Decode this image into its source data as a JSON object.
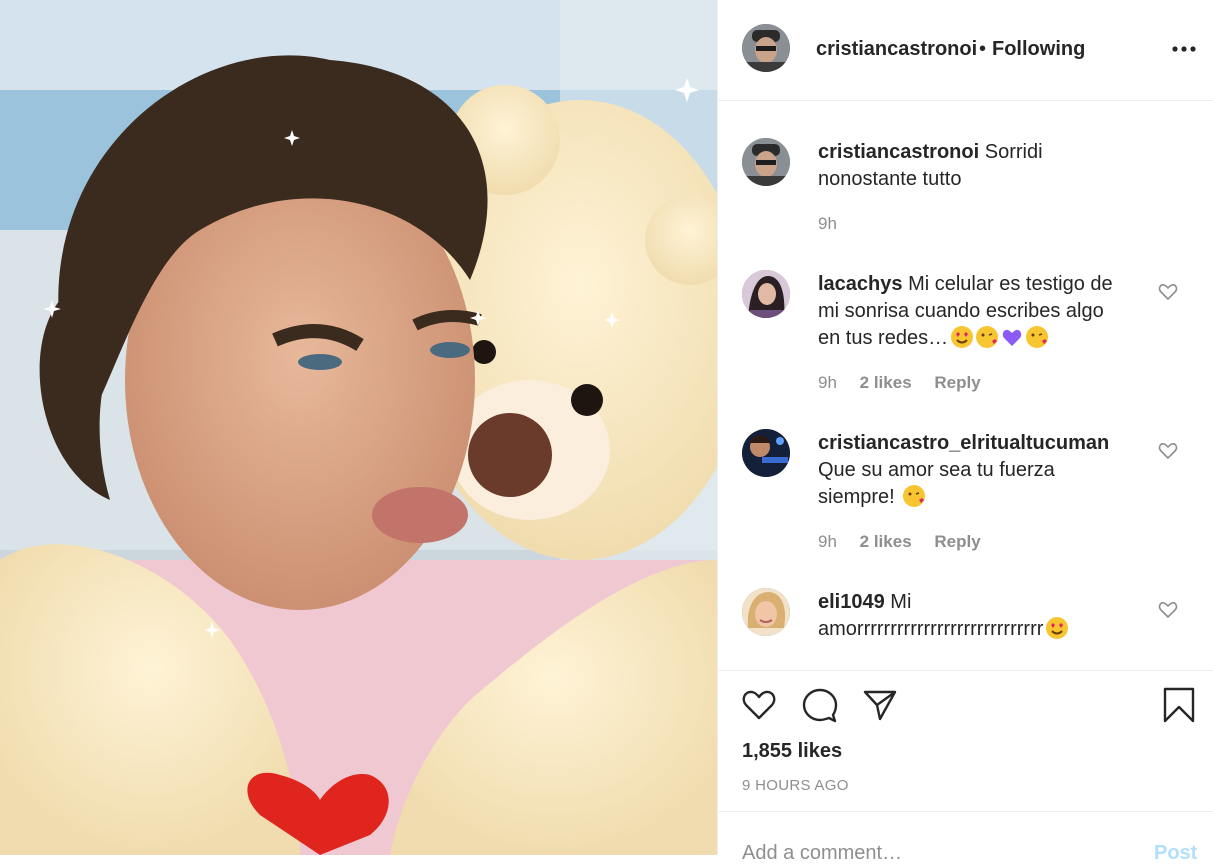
{
  "post": {
    "username": "cristiancastronoi",
    "separator": "•",
    "follow_status": "Following",
    "more_icon": "more-horizontal-icon",
    "caption": {
      "username": "cristiancastronoi",
      "text": "Sorridi nonostante tutto",
      "time": "9h"
    },
    "comments": [
      {
        "username": "lacachys",
        "text": "Mi celular es testigo de mi sonrisa cuando escribes algo en tus redes…",
        "emojis": [
          "heart-eyes",
          "kiss",
          "purple-heart",
          "kiss"
        ],
        "time": "9h",
        "likes": "2 likes",
        "reply": "Reply"
      },
      {
        "username": "cristiancastro_elritualtucuman",
        "text": "Que su amor sea tu fuerza siempre!",
        "emojis": [
          "kiss"
        ],
        "time": "9h",
        "likes": "2 likes",
        "reply": "Reply"
      },
      {
        "username": "eli1049",
        "text": "Mi amorrrrrrrrrrrrrrrrrrrrrrrrrrrr",
        "emojis": [
          "heart-eyes"
        ]
      }
    ],
    "likes": "1,855 likes",
    "posted_ago": "9 HOURS AGO",
    "add_comment_placeholder": "Add a comment…",
    "post_label": "Post"
  },
  "icons": {
    "like": "heart-icon",
    "comment": "comment-bubble-icon",
    "share": "paper-plane-icon",
    "save": "bookmark-icon"
  },
  "colors": {
    "text": "#262626",
    "secondary": "#8e8e8e",
    "divider": "#efefef",
    "post_button": "#b2dffc"
  }
}
